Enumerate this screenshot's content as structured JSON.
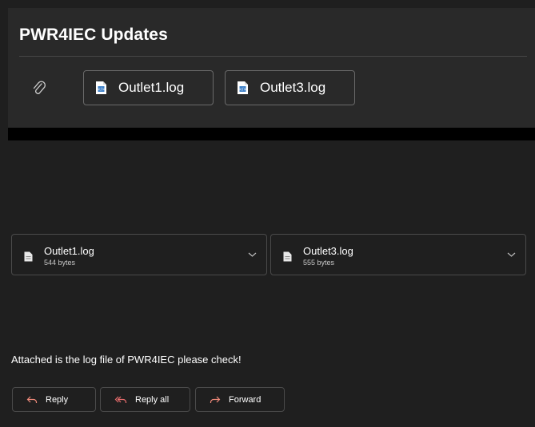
{
  "message": {
    "subject": "PWR4IEC Updates",
    "body": "Attached is the log file of PWR4IEC please check!"
  },
  "header_attachments": [
    {
      "name": "Outlet1.log",
      "icon": "log-file-icon"
    },
    {
      "name": "Outlet3.log",
      "icon": "log-file-icon"
    }
  ],
  "attachments": [
    {
      "name": "Outlet1.log",
      "size": "544 bytes"
    },
    {
      "name": "Outlet3.log",
      "size": "555 bytes"
    }
  ],
  "actions": {
    "reply": "Reply",
    "reply_all": "Reply all",
    "forward": "Forward"
  },
  "colors": {
    "background": "#1f1f1f",
    "header": "#292929",
    "accent_icon": "#f08a7a",
    "reply_all_icon": "#e86d6d"
  }
}
